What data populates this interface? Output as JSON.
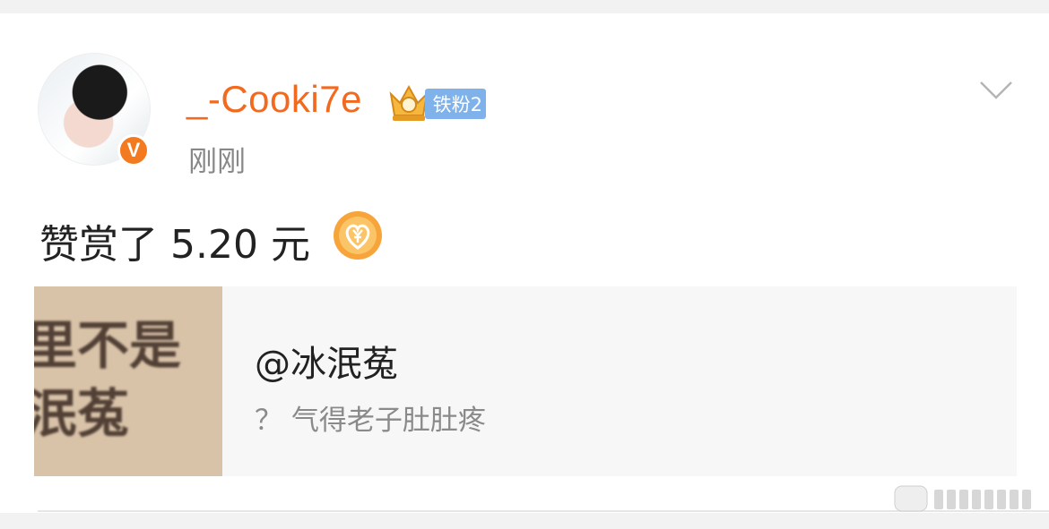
{
  "post": {
    "username": "_-Cooki7e",
    "fan_badge": "铁粉2",
    "verified_mark": "V",
    "time": "刚刚",
    "reward_text": "赞赏了 5.20 元",
    "icons": {
      "avatar": "avatar",
      "verified": "verified-badge-icon",
      "crown": "crown-badge-icon",
      "menu": "chevron-down-icon",
      "coin": "reward-coin-icon"
    }
  },
  "shared_card": {
    "thumbnail_text": "里不是\n泯菟",
    "title": "@冰泯菟",
    "subtitle": "？ 气得老子肚肚疼"
  },
  "colors": {
    "accent": "#f36a1f",
    "badge_blue": "#7fb2ea",
    "card_bg": "#f7f7f7",
    "page_bg": "#f2f2f2"
  }
}
